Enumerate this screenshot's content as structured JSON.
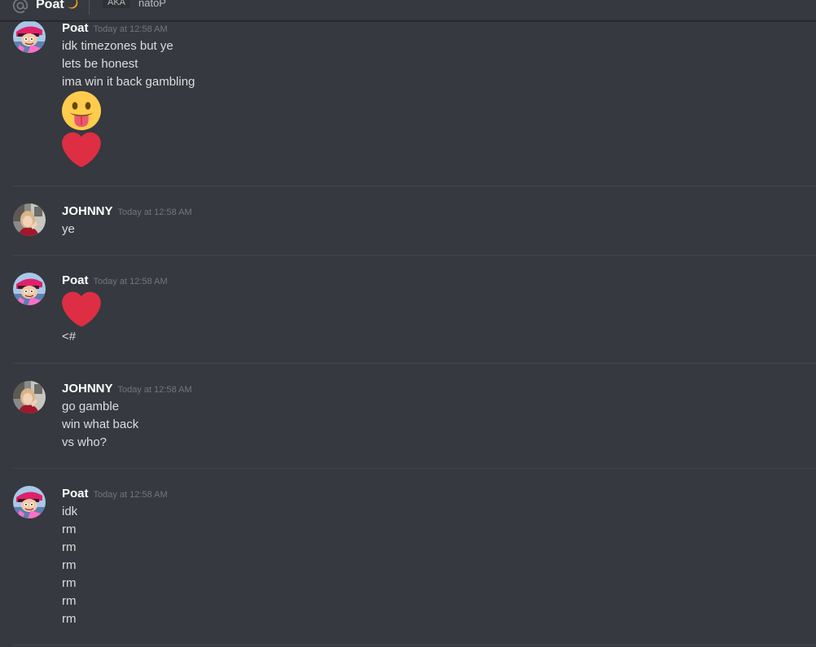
{
  "header": {
    "channel_name": "Poat",
    "aka_label": "AKA",
    "aka_name": "natoP",
    "icons": [
      "at-icon",
      "moon-status-icon"
    ]
  },
  "colors": {
    "background": "#36393f",
    "username": "#ffffff",
    "message_text": "#dcddde",
    "timestamp": "#72767d",
    "separator": "#42454a",
    "heart": "#dd2e44",
    "tongue_face": "#ffcc4d"
  },
  "messages": [
    {
      "author": "Poat",
      "timestamp": "Today at 12:58 AM",
      "lines": [
        "idk timezones but ye",
        "lets be honest",
        "ima win it back gambling"
      ],
      "emojis": [
        "face-with-tongue-emoji",
        "red-heart-emoji"
      ]
    },
    {
      "author": "JOHNNY",
      "timestamp": "Today at 12:58 AM",
      "lines": [
        "ye"
      ]
    },
    {
      "author": "Poat",
      "timestamp": "Today at 12:58 AM",
      "emojis": [
        "red-heart-emoji"
      ],
      "lines": [
        "<#"
      ]
    },
    {
      "author": "JOHNNY",
      "timestamp": "Today at 12:58 AM",
      "lines": [
        "go gamble",
        "win what back",
        "vs who?"
      ]
    },
    {
      "author": "Poat",
      "timestamp": "Today at 12:58 AM",
      "lines": [
        "idk",
        "rm",
        "rm",
        "rm",
        "rm",
        "rm",
        "rm"
      ]
    }
  ]
}
